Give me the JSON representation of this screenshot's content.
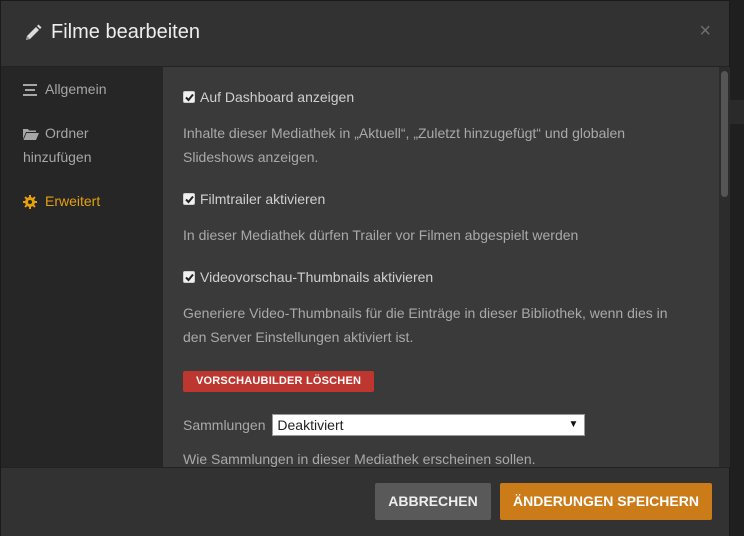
{
  "dialog": {
    "title": "Filme bearbeiten",
    "close_glyph": "×",
    "title_icon": "pencil-icon"
  },
  "sidebar": {
    "items": [
      {
        "label": "Allgemein",
        "icon": "list-icon",
        "active": false
      },
      {
        "label_line1": "Ordner",
        "label_line2": "hinzufügen",
        "icon": "folder-open-icon",
        "active": false
      },
      {
        "label": "Erweitert",
        "icon": "gear-icon",
        "active": true
      }
    ]
  },
  "settings": {
    "dashboard": {
      "label": "Auf Dashboard anzeigen",
      "checked": true,
      "desc_line1": "Inhalte dieser Mediathek in „Aktuell“, „Zuletzt hinzugefügt“ und globalen",
      "desc_line2": "Slideshows anzeigen."
    },
    "trailer": {
      "label": "Filmtrailer aktivieren",
      "checked": true,
      "desc": "In dieser Mediathek dürfen Trailer vor Filmen abgespielt werden"
    },
    "thumbnails": {
      "label": "Videovorschau-Thumbnails aktivieren",
      "checked": true,
      "desc_line1": "Generiere Video-Thumbnails für die Einträge in dieser Bibliothek, wenn dies in",
      "desc_line2": "den Server Einstellungen aktiviert ist."
    },
    "delete_previews_button": "VORSCHAUBILDER LÖSCHEN",
    "collections": {
      "label": "Sammlungen",
      "selected": "Deaktiviert",
      "desc": "Wie Sammlungen in dieser Mediathek erscheinen sollen."
    }
  },
  "footer": {
    "cancel": "ABBRECHEN",
    "save": "ÄNDERUNGEN SPEICHERN"
  },
  "colors": {
    "accent": "#e5a00d",
    "save_button": "#cc7b19",
    "danger": "#bd362f"
  }
}
